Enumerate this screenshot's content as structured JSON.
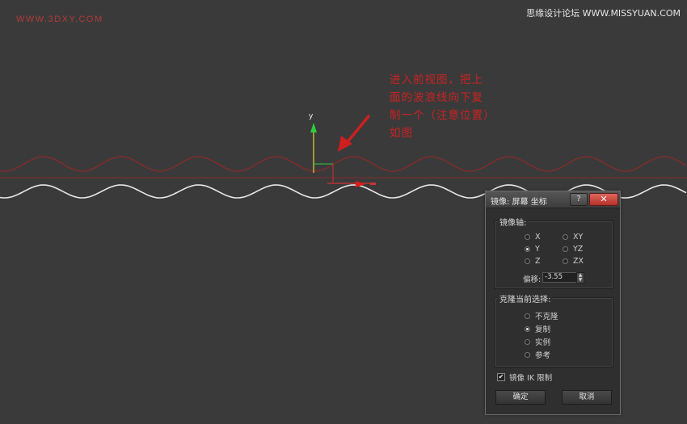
{
  "watermark_left": "WWW.3DXY.COM",
  "watermark_right": "思缘设计论坛 WWW.MISSYUAN.COM",
  "annotation": "进入前视图，把上面的波浪线向下复制一个（注意位置）如图",
  "gizmo": {
    "y_axis_label": "y"
  },
  "colors": {
    "background": "#3a3a3a",
    "red_wave": "#8a2a2a",
    "white_wave": "#e8e8e8",
    "annotation": "#cc2222"
  },
  "dialog": {
    "title": "镜像: 屏幕 坐标",
    "help_label": "?",
    "close_label": "✕",
    "mirror_axis": {
      "label": "镜像轴:",
      "options": [
        {
          "label": "X",
          "selected": false
        },
        {
          "label": "Y",
          "selected": true
        },
        {
          "label": "Z",
          "selected": false
        },
        {
          "label": "XY",
          "selected": false
        },
        {
          "label": "YZ",
          "selected": false
        },
        {
          "label": "ZX",
          "selected": false
        }
      ],
      "offset_label": "偏移:",
      "offset_value": "-3.55"
    },
    "clone": {
      "label": "克隆当前选择:",
      "options": [
        {
          "label": "不克隆",
          "selected": false
        },
        {
          "label": "复制",
          "selected": true
        },
        {
          "label": "实例",
          "selected": false
        },
        {
          "label": "参考",
          "selected": false
        }
      ]
    },
    "ik_label": "镜像 IK 限制",
    "ik_checked": true,
    "ok_label": "确定",
    "cancel_label": "取消"
  }
}
